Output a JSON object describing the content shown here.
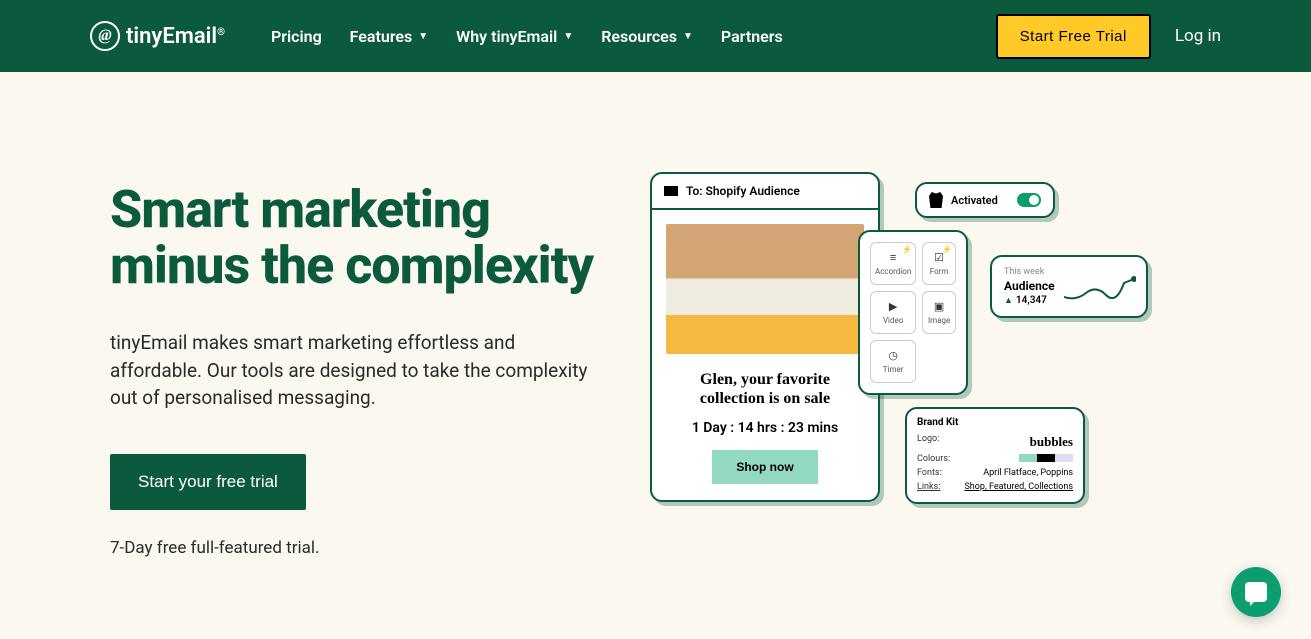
{
  "brand": {
    "name": "tinyEmail",
    "registered": "®"
  },
  "nav": {
    "pricing": "Pricing",
    "features": "Features",
    "why": "Why tinyEmail",
    "resources": "Resources",
    "partners": "Partners"
  },
  "header_cta": "Start Free Trial",
  "login": "Log in",
  "hero": {
    "title": "Smart marketing minus the complexity",
    "description": "tinyEmail makes smart marketing effortless and affordable. Our tools are designed to take the complexity out of personalised messaging.",
    "cta": "Start your free trial",
    "trial_note": "7-Day free full-featured trial."
  },
  "email_preview": {
    "to": "To: Shopify Audience",
    "headline": "Glen, your favorite collection is on sale",
    "countdown": "1 Day : 14 hrs : 23 mins",
    "shop": "Shop now"
  },
  "widgets": {
    "accordion": "Accordion",
    "form": "Form",
    "video": "Video",
    "image": "Image",
    "timer": "Timer"
  },
  "activated": {
    "label": "Activated"
  },
  "stats": {
    "period": "This week",
    "title": "Audience",
    "value": "14,347"
  },
  "brand_kit": {
    "title": "Brand Kit",
    "logo_label": "Logo:",
    "logo_value": "bubbles",
    "colours_label": "Colours:",
    "fonts_label": "Fonts:",
    "fonts_value": "April Flatface, Poppins",
    "links_label": "Links:",
    "link_shop": "Shop",
    "link_featured": "Featured",
    "link_collections": "Collections"
  },
  "colors": {
    "swatch1": "#93d8c1",
    "swatch2": "#000000",
    "swatch3": "#dcdcf5"
  }
}
